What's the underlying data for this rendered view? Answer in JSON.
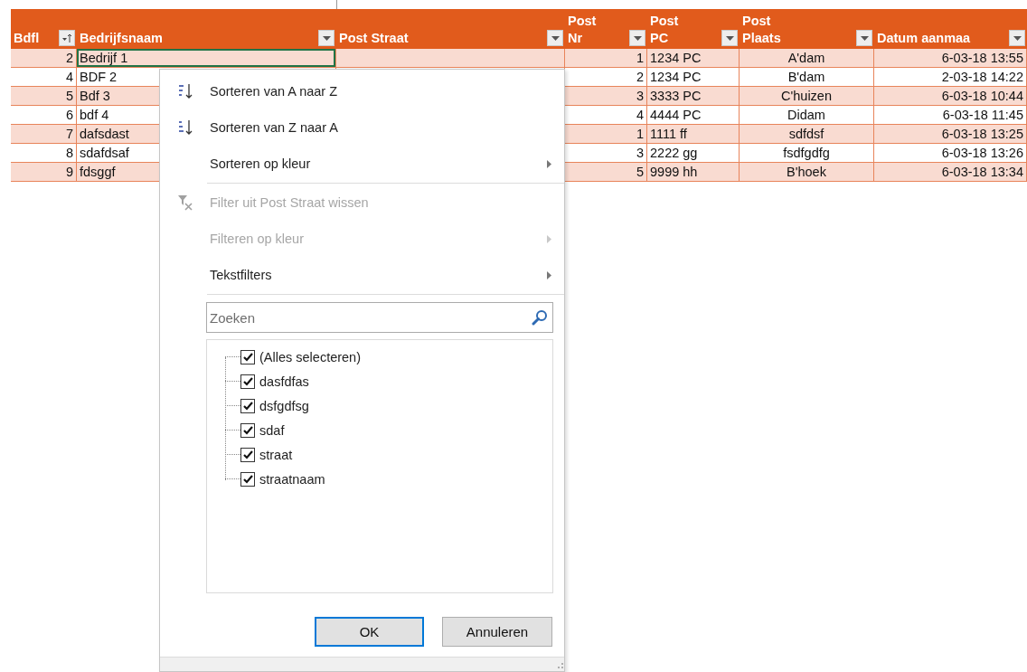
{
  "table": {
    "columns": [
      {
        "lines": [
          "Bdfl"
        ],
        "kind": "sort"
      },
      {
        "lines": [
          "Bedrijfsnaam"
        ],
        "kind": "filter"
      },
      {
        "lines": [
          "Post Straat"
        ],
        "kind": "filter"
      },
      {
        "lines": [
          "Post",
          "Nr"
        ],
        "kind": "filter"
      },
      {
        "lines": [
          "Post",
          "PC"
        ],
        "kind": "filter"
      },
      {
        "lines": [
          "Post",
          "Plaats"
        ],
        "kind": "filter"
      },
      {
        "lines": [
          "Datum aanmaa"
        ],
        "kind": "filter"
      }
    ],
    "rows": [
      {
        "id": "2",
        "name": "Bedrijf 1",
        "nr": "1",
        "pc": "1234 PC",
        "plaats": "A'dam",
        "datum": "6-03-18 13:55",
        "selected": true
      },
      {
        "id": "4",
        "name": "BDF 2",
        "nr": "2",
        "pc": "1234 PC",
        "plaats": "B'dam",
        "datum": "2-03-18 14:22",
        "selected": false
      },
      {
        "id": "5",
        "name": "Bdf 3",
        "nr": "3",
        "pc": "3333 PC",
        "plaats": "C'huizen",
        "datum": "6-03-18 10:44",
        "selected": false
      },
      {
        "id": "6",
        "name": "bdf 4",
        "nr": "4",
        "pc": "4444 PC",
        "plaats": "Didam",
        "datum": "6-03-18 11:45",
        "selected": false
      },
      {
        "id": "7",
        "name": "dafsdast",
        "nr": "1",
        "pc": "1111 ff",
        "plaats": "sdfdsf",
        "datum": "6-03-18 13:25",
        "selected": false
      },
      {
        "id": "8",
        "name": "sdafdsaf",
        "nr": "3",
        "pc": "2222 gg",
        "plaats": "fsdfgdfg",
        "datum": "6-03-18 13:26",
        "selected": false
      },
      {
        "id": "9",
        "name": "fdsggf",
        "nr": "5",
        "pc": "9999 hh",
        "plaats": "B'hoek",
        "datum": "6-03-18 13:34",
        "selected": false
      }
    ]
  },
  "filter_menu": {
    "items": [
      {
        "kind": "sort-asc",
        "label": "Sorteren van A naar Z",
        "disabled": false,
        "submenu": false
      },
      {
        "kind": "sort-desc",
        "label": "Sorteren van Z naar A",
        "disabled": false,
        "submenu": false
      },
      {
        "kind": "plain",
        "label": "Sorteren op kleur",
        "disabled": false,
        "submenu": true
      },
      {
        "kind": "separator"
      },
      {
        "kind": "clear-filter",
        "label": "Filter uit Post Straat wissen",
        "disabled": true,
        "submenu": false
      },
      {
        "kind": "plain",
        "label": "Filteren op kleur",
        "disabled": true,
        "submenu": true
      },
      {
        "kind": "plain",
        "label": "Tekstfilters",
        "disabled": false,
        "submenu": true
      },
      {
        "kind": "separator"
      }
    ],
    "search": {
      "placeholder": "Zoeken"
    },
    "values": [
      {
        "label": "(Alles selecteren)",
        "checked": true
      },
      {
        "label": "dasfdfas",
        "checked": true
      },
      {
        "label": "dsfgdfsg",
        "checked": true
      },
      {
        "label": "sdaf",
        "checked": true
      },
      {
        "label": "straat",
        "checked": true
      },
      {
        "label": "straatnaam",
        "checked": true
      }
    ],
    "buttons": [
      {
        "label": "OK",
        "selected": true
      },
      {
        "label": "Annuleren",
        "selected": false
      }
    ]
  }
}
